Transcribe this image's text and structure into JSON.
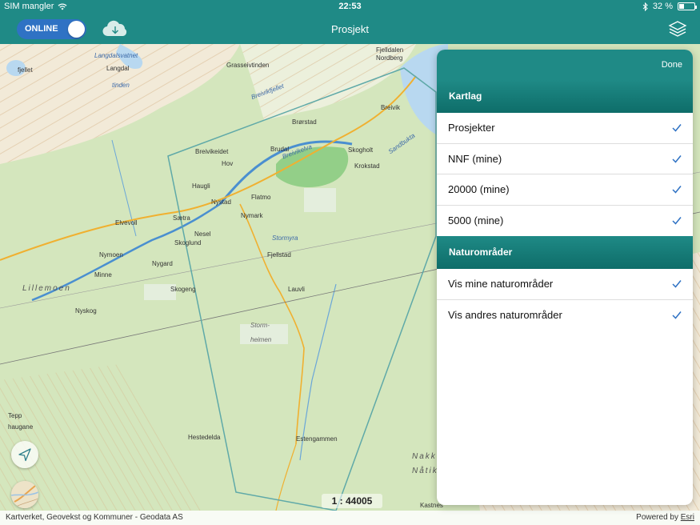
{
  "status_bar": {
    "carrier": "SIM mangler",
    "time": "22:53",
    "battery": "32 %",
    "battery_level": 0.32
  },
  "nav": {
    "title": "Prosjekt",
    "toggle_label": "ONLINE",
    "toggle_on": true
  },
  "map": {
    "scale": "1 : 44005",
    "labels": {
      "langdalsvatnet": "Langdalsvatnet",
      "langdal": "Langdal",
      "tinden": "tinden",
      "fjellet": "fjellet",
      "fjelldalen": "Fjelldalen",
      "nordberg": "Nordberg",
      "grasseivtinden": "Grasseivtinden",
      "breivikfjellet": "Breivikfjellet",
      "breivik": "Breivik",
      "brorstad": "Brørstad",
      "breivikeidet": "Breivikeidet",
      "brudal": "Brudal",
      "hov": "Hov",
      "skogholt": "Skogholt",
      "krokstad": "Krokstad",
      "haugli": "Haugli",
      "nystad": "Nystad",
      "flatmo": "Flatmo",
      "nymark": "Nymark",
      "saetra": "Sætra",
      "elvevoll": "Elvevoll",
      "nesel": "Nesel",
      "skoglund": "Skoglund",
      "stormyra": "Stormyra",
      "fjellstad": "Fjellstad",
      "nymoen": "Nymoen",
      "nygard": "Nygard",
      "minne": "Minne",
      "lillemoen": "Lillemoen",
      "skogeng": "Skogeng",
      "lauvli": "Lauvli",
      "nyskog": "Nyskog",
      "storm": "Storm-",
      "heimen": "heimen",
      "hestedelda": "Hestedelda",
      "estengammen": "Estengammen",
      "tepp": "Tepp",
      "haugane": "haugane",
      "nakk": "Nakk",
      "natik": "Nåtik",
      "breivikelva": "Breivikelva",
      "sandbukta": "Sandbukta",
      "kastnes": "Kastnes"
    }
  },
  "attribution": {
    "left": "Kartverket, Geovekst og Kommuner - Geodata AS",
    "powered": "Powered by ",
    "esri": "Esri"
  },
  "popover": {
    "done_label": "Done",
    "sections": [
      {
        "title": "Kartlag",
        "rows": [
          "Prosjekter",
          "NNF (mine)",
          "20000 (mine)",
          "5000 (mine)"
        ]
      },
      {
        "title": "Naturområder",
        "rows": [
          "Vis mine naturområder",
          "Vis andres naturområder"
        ]
      }
    ]
  },
  "colors": {
    "accent": "#1f8a86",
    "check": "#2f72c4",
    "toggle": "#2f72c4"
  },
  "icons": {
    "cloud": "cloud-download-icon",
    "layers": "layers-icon",
    "wifi": "wifi-icon",
    "bluetooth": "bluetooth-icon",
    "locate": "location-arrow-icon",
    "basemap": "basemap-icon",
    "check": "checkmark-icon"
  }
}
